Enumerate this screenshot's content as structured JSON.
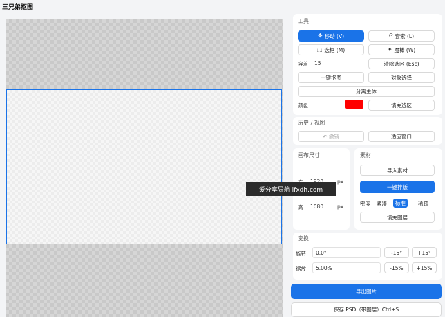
{
  "app": {
    "title": "三兄弟抠图"
  },
  "tools": {
    "heading": "工具",
    "move": {
      "label": "移动 (V)",
      "icon": "move-icon"
    },
    "lasso": {
      "label": "套索 (L)",
      "icon": "lasso-icon"
    },
    "marquee": {
      "label": "选框 (M)",
      "icon": "marquee-icon"
    },
    "magic_wand": {
      "label": "魔棒 (W)",
      "icon": "magic-wand-icon"
    },
    "tolerance_label": "容差",
    "tolerance_value": "15",
    "clear_selection": "清除选区 (Esc)",
    "one_click_cutout": "一键抠图",
    "object_select": "对象选择",
    "separate_subject": "分离主体",
    "color_label": "颜色",
    "color_value": "#ff0000",
    "fill_selection": "填充选区"
  },
  "history": {
    "heading": "历史 / 视图",
    "undo": "↶ 撤销",
    "fit_window": "适应窗口"
  },
  "canvas_size": {
    "heading": "画布尺寸",
    "width_label": "宽",
    "width_value": "1920",
    "width_unit": "px",
    "height_label": "高",
    "height_value": "1080",
    "height_unit": "px"
  },
  "assets": {
    "heading": "素材",
    "import": "导入素材",
    "auto_layout": "一键排版",
    "density_label": "密度",
    "density_options": [
      "紧凑",
      "标准",
      "稀疏"
    ],
    "density_selected": "标准",
    "fill_layer": "填充图层"
  },
  "transform": {
    "heading": "变换",
    "rotate_label": "旋转",
    "rotate_value": "0.0°",
    "rotate_minus": "-15°",
    "rotate_plus": "+15°",
    "scale_label": "缩放",
    "scale_value": "5.00%",
    "scale_minus": "-15%",
    "scale_plus": "+15%"
  },
  "export": {
    "export_image": "导出图片",
    "save_psd": "保存 PSD（带图层）Ctrl+S"
  },
  "watermark": "爱分享导航 ifxdh.com",
  "colors": {
    "accent": "#1a73e8",
    "fill_color": "#ff0000"
  }
}
